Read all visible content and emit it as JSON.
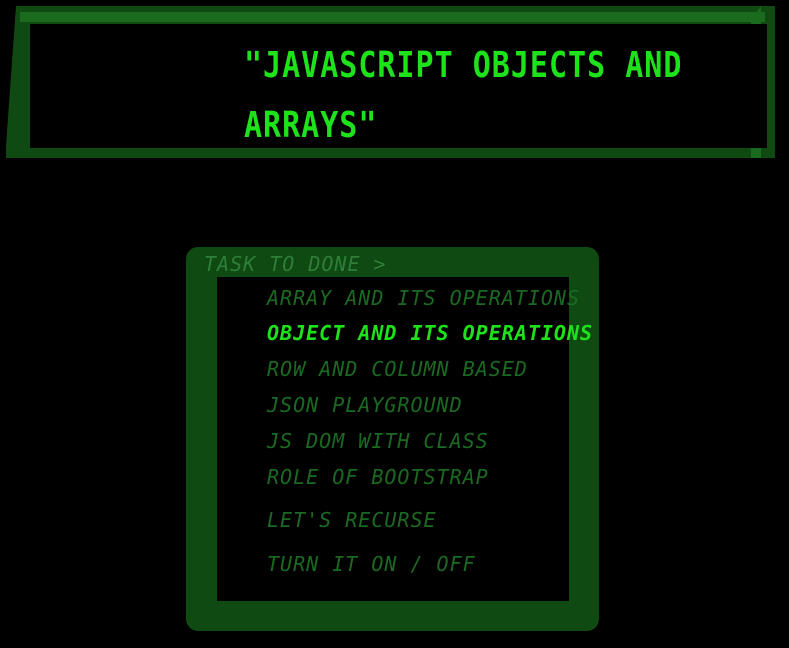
{
  "header": {
    "title": "\"JavaScript Objects and Arrays\""
  },
  "tasks": {
    "label": "TASK TO DONE >",
    "items": [
      {
        "label": "ARRAY AND ITS OPERATIONS",
        "active": false
      },
      {
        "label": "OBJECT AND ITS OPERATIONS",
        "active": true
      },
      {
        "label": "ROW AND COLUMN BASED",
        "active": false
      },
      {
        "label": "JSON PLAYGROUND",
        "active": false
      },
      {
        "label": "JS DOM WITH CLASS",
        "active": false
      },
      {
        "label": "ROLE OF BOOTSTRAP",
        "active": false
      },
      {
        "label": "LET'S RECURSE",
        "active": false
      },
      {
        "label": "TURN IT ON / OFF",
        "active": false
      }
    ]
  },
  "colors": {
    "background": "#000000",
    "frame_dark": "#0e4a12",
    "frame_light": "#1a6b1d",
    "accent_active": "#1ee31a",
    "text_inactive": "#1b6a21"
  }
}
